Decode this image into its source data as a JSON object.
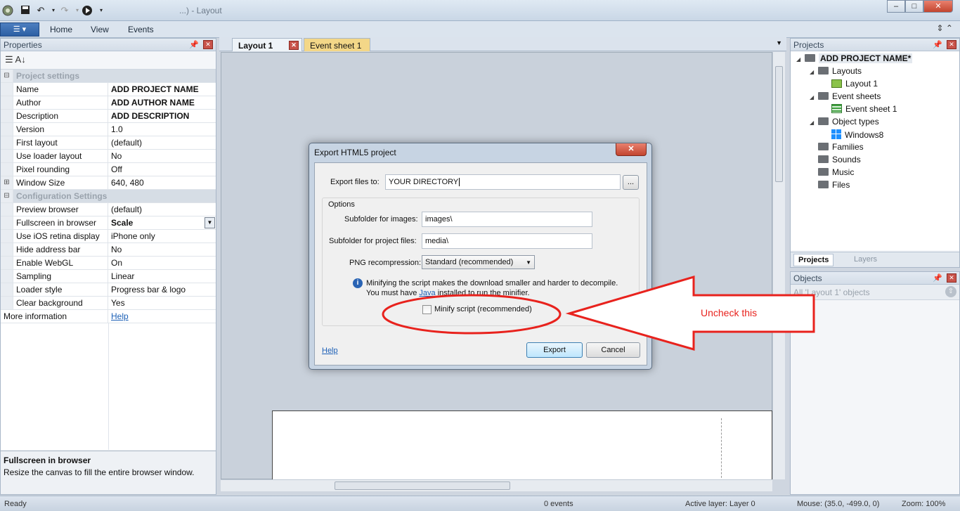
{
  "window": {
    "title_fragment": "...) - Layout",
    "controls": {
      "minimize": "–",
      "maximize": "□",
      "close": "✕"
    }
  },
  "ribbon": {
    "app_menu_glyph": "☰ ▾",
    "tabs": [
      "Home",
      "View",
      "Events"
    ],
    "right_controls": "⇕  ⌃"
  },
  "properties": {
    "title": "Properties",
    "toolbar": "☰  A↓",
    "rows": [
      {
        "type": "cat",
        "k": "Project settings"
      },
      {
        "k": "Name",
        "v": "ADD PROJECT NAME",
        "bold": true
      },
      {
        "k": "Author",
        "v": "ADD AUTHOR NAME",
        "bold": true
      },
      {
        "k": "Description",
        "v": "ADD DESCRIPTION",
        "bold": true
      },
      {
        "k": "Version",
        "v": "1.0"
      },
      {
        "k": "First layout",
        "v": "(default)"
      },
      {
        "k": "Use loader layout",
        "v": "No"
      },
      {
        "k": "Pixel rounding",
        "v": "Off"
      },
      {
        "k": "Window Size",
        "v": "640, 480",
        "expand": true
      },
      {
        "type": "cat",
        "k": "Configuration Settings"
      },
      {
        "k": "Preview browser",
        "v": "(default)"
      },
      {
        "k": "Fullscreen in browser",
        "v": "Scale",
        "bold": true,
        "dropdown": true
      },
      {
        "k": "Use iOS retina display",
        "v": "iPhone only"
      },
      {
        "k": "Hide address bar",
        "v": "No"
      },
      {
        "k": "Enable WebGL",
        "v": "On"
      },
      {
        "k": "Sampling",
        "v": "Linear"
      },
      {
        "k": "Loader style",
        "v": "Progress bar & logo"
      },
      {
        "k": "Clear background",
        "v": "Yes"
      },
      {
        "k": "More information",
        "v": "Help",
        "link": true,
        "noindent": true
      }
    ],
    "desc_title": "Fullscreen in browser",
    "desc_text": "Resize the canvas to fill the entire browser window."
  },
  "doc_tabs": [
    {
      "label": "Layout 1",
      "active": true
    },
    {
      "label": "Event sheet 1",
      "active": false
    }
  ],
  "projects": {
    "title": "Projects",
    "tree": [
      {
        "label": "ADD PROJECT NAME*",
        "level": 0,
        "bold": true,
        "expanded": true
      },
      {
        "label": "Layouts",
        "level": 1,
        "expanded": true
      },
      {
        "label": "Layout 1",
        "level": 2,
        "icon": "layout"
      },
      {
        "label": "Event sheets",
        "level": 1,
        "expanded": true
      },
      {
        "label": "Event sheet 1",
        "level": 2,
        "icon": "eventsheet"
      },
      {
        "label": "Object types",
        "level": 1,
        "expanded": true
      },
      {
        "label": "Windows8",
        "level": 2,
        "icon": "windows"
      },
      {
        "label": "Families",
        "level": 1
      },
      {
        "label": "Sounds",
        "level": 1
      },
      {
        "label": "Music",
        "level": 1
      },
      {
        "label": "Files",
        "level": 1
      }
    ],
    "bottom_tabs": [
      "Projects",
      "Layers"
    ]
  },
  "objects": {
    "title": "Objects",
    "filter": "All 'Layout 1' objects"
  },
  "statusbar": {
    "status": "Ready",
    "events": "0 events",
    "active_layer": "Active layer: Layer 0",
    "mouse": "Mouse: (35.0, -499.0, 0)",
    "zoom": "Zoom: 100%"
  },
  "dialog": {
    "title": "Export HTML5 project",
    "close_glyph": "✕",
    "export_label": "Export files to:",
    "export_value": "YOUR DIRECTORY",
    "browse_label": "...",
    "options_label": "Options",
    "images_label": "Subfolder for images:",
    "images_value": "images\\",
    "project_files_label": "Subfolder for project files:",
    "project_files_value": "media\\",
    "png_label": "PNG recompression:",
    "png_value": "Standard (recommended)",
    "info_line1": "Minifying the script makes the download smaller and harder to decompile.",
    "info_line2_a": "You must have ",
    "info_line2_link": "Java",
    "info_line2_b": " installed to run the minifier.",
    "minify_label": "Minify script (recommended)",
    "help_label": "Help",
    "export_button": "Export",
    "cancel_button": "Cancel"
  },
  "annotation": {
    "text": "Uncheck this",
    "color": "#e8221d"
  }
}
